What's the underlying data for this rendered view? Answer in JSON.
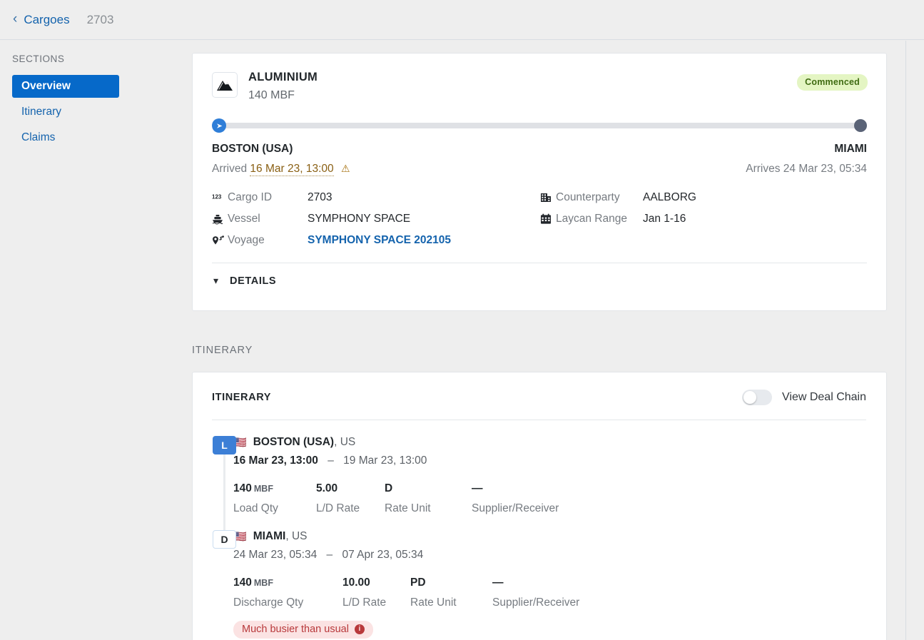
{
  "breadcrumb": {
    "back_icon": "chevron-left-icon",
    "parent": "Cargoes",
    "current": "2703"
  },
  "sidebar": {
    "heading": "SECTIONS",
    "items": [
      {
        "label": "Overview",
        "active": true
      },
      {
        "label": "Itinerary",
        "active": false
      },
      {
        "label": "Claims",
        "active": false
      }
    ]
  },
  "overview": {
    "commodity_icon": "mountain-icon",
    "commodity": "ALUMINIUM",
    "quantity": "140 MBF",
    "status_badge": "Commenced",
    "status_badge_bg": "#e4f5c3",
    "status_badge_color": "#3f6b12",
    "progress": {
      "start_icon": "play-arrow-icon",
      "end_icon": "end-dot-icon",
      "percent": 100
    },
    "origin": {
      "port": "BOSTON (USA)",
      "event_label": "Arrived",
      "event_time": "16 Mar 23, 13:00",
      "warning_icon": "warning-triangle-icon",
      "warning_color": "#a6700d"
    },
    "destination": {
      "port": "MIAMI",
      "event_label": "Arrives",
      "event_time": "24 Mar 23, 05:34"
    },
    "details_left": [
      {
        "icon": "number-123-icon",
        "label": "Cargo ID",
        "value": "2703",
        "link": false
      },
      {
        "icon": "ship-icon",
        "label": "Vessel",
        "value": "SYMPHONY SPACE",
        "link": false
      },
      {
        "icon": "voyage-pin-icon",
        "label": "Voyage",
        "value": "SYMPHONY SPACE 202105",
        "link": true
      }
    ],
    "details_right": [
      {
        "icon": "building-icon",
        "label": "Counterparty",
        "value": "AALBORG",
        "link": false
      },
      {
        "icon": "calendar-icon",
        "label": "Laycan Range",
        "value": "Jan 1-16",
        "link": false
      }
    ],
    "details_section": {
      "chevron_icon": "chevron-down-icon",
      "label": "DETAILS"
    }
  },
  "itinerary_section_label": "ITINERARY",
  "itinerary": {
    "title": "ITINERARY",
    "deal_chain_toggle": {
      "label": "View Deal Chain",
      "checked": false
    },
    "legs": [
      {
        "badge": "L",
        "badge_type": "load",
        "flag": "🇺🇸",
        "port": "BOSTON (USA)",
        "country": ", US",
        "date_from": "16 Mar 23, 13:00",
        "date_dash": "–",
        "date_to": "19 Mar 23, 13:00",
        "metrics": [
          {
            "value": "140",
            "unit": "MBF",
            "label": "Load Qty"
          },
          {
            "value": "5.00",
            "unit": "",
            "label": "L/D Rate"
          },
          {
            "value": "D",
            "unit": "",
            "label": "Rate Unit"
          },
          {
            "value": "—",
            "unit": "",
            "label": "Supplier/Receiver"
          }
        ],
        "alert": null
      },
      {
        "badge": "D",
        "badge_type": "discharge",
        "flag": "🇺🇸",
        "port": "MIAMI",
        "country": ", US",
        "date_from": "24 Mar 23, 05:34",
        "date_dash": "–",
        "date_to": "07 Apr 23, 05:34",
        "metrics": [
          {
            "value": "140",
            "unit": "MBF",
            "label": "Discharge Qty"
          },
          {
            "value": "10.00",
            "unit": "",
            "label": "L/D Rate"
          },
          {
            "value": "PD",
            "unit": "",
            "label": "Rate Unit"
          },
          {
            "value": "—",
            "unit": "",
            "label": "Supplier/Receiver"
          }
        ],
        "alert": {
          "text": "Much busier than usual",
          "icon": "info-icon",
          "bg": "#fbe3e3",
          "color": "#b8393b"
        }
      }
    ]
  },
  "colors": {
    "accent": "#0669c9",
    "link": "#1463ad",
    "page_bg": "#eeeeee",
    "card_bg": "#ffffff",
    "border": "#e2e5e8"
  }
}
